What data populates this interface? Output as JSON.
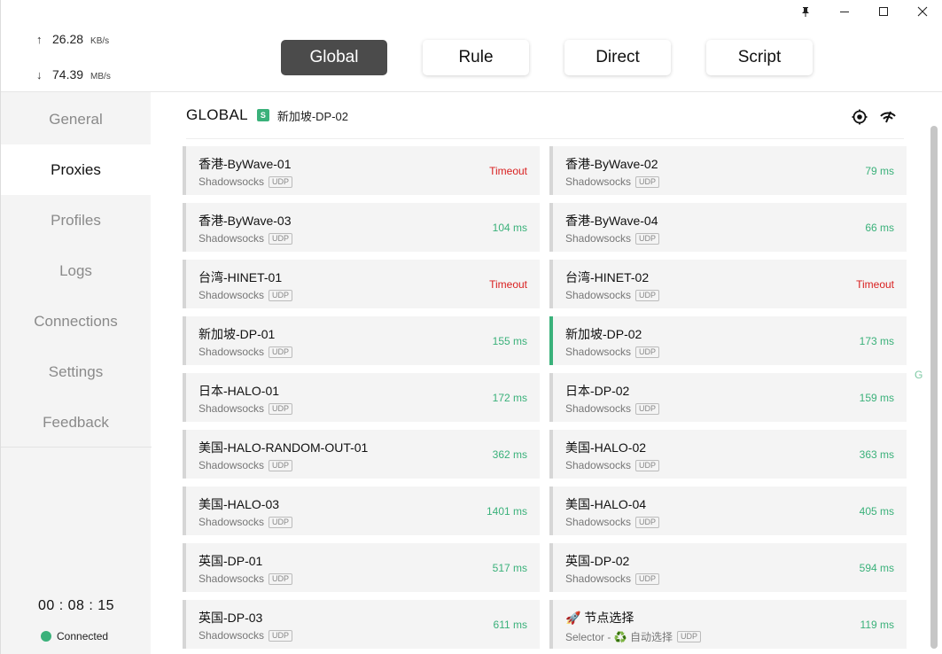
{
  "window": {
    "controls": [
      {
        "icon": "pin-icon"
      },
      {
        "icon": "minimize-icon"
      },
      {
        "icon": "maximize-icon"
      },
      {
        "icon": "close-icon"
      }
    ]
  },
  "traffic": {
    "upload": {
      "arrow": "↑",
      "value": "26.28",
      "unit": "KB/s"
    },
    "download": {
      "arrow": "↓",
      "value": "74.39",
      "unit": "MB/s"
    }
  },
  "nav": {
    "items": [
      "General",
      "Proxies",
      "Profiles",
      "Logs",
      "Connections",
      "Settings",
      "Feedback"
    ],
    "active": "Proxies"
  },
  "footer": {
    "timer": "00 : 08 : 15",
    "status": "Connected"
  },
  "modes": {
    "items": [
      "Global",
      "Rule",
      "Direct",
      "Script"
    ],
    "active": "Global"
  },
  "group": {
    "name": "GLOBAL",
    "badge": "S",
    "selected": "新加坡-DP-02",
    "icons": [
      "locate-icon",
      "speed-test-icon"
    ]
  },
  "proxies": [
    {
      "name": "香港-ByWave-01",
      "type": "Shadowsocks",
      "udp": "UDP",
      "delay": "Timeout",
      "timeout": true
    },
    {
      "name": "香港-ByWave-02",
      "type": "Shadowsocks",
      "udp": "UDP",
      "delay": "79 ms"
    },
    {
      "name": "香港-ByWave-03",
      "type": "Shadowsocks",
      "udp": "UDP",
      "delay": "104 ms"
    },
    {
      "name": "香港-ByWave-04",
      "type": "Shadowsocks",
      "udp": "UDP",
      "delay": "66 ms"
    },
    {
      "name": "台湾-HINET-01",
      "type": "Shadowsocks",
      "udp": "UDP",
      "delay": "Timeout",
      "timeout": true
    },
    {
      "name": "台湾-HINET-02",
      "type": "Shadowsocks",
      "udp": "UDP",
      "delay": "Timeout",
      "timeout": true
    },
    {
      "name": "新加坡-DP-01",
      "type": "Shadowsocks",
      "udp": "UDP",
      "delay": "155 ms"
    },
    {
      "name": "新加坡-DP-02",
      "type": "Shadowsocks",
      "udp": "UDP",
      "delay": "173 ms",
      "selected": true
    },
    {
      "name": "日本-HALO-01",
      "type": "Shadowsocks",
      "udp": "UDP",
      "delay": "172 ms"
    },
    {
      "name": "日本-DP-02",
      "type": "Shadowsocks",
      "udp": "UDP",
      "delay": "159 ms"
    },
    {
      "name": "美国-HALO-RANDOM-OUT-01",
      "type": "Shadowsocks",
      "udp": "UDP",
      "delay": "362 ms"
    },
    {
      "name": "美国-HALO-02",
      "type": "Shadowsocks",
      "udp": "UDP",
      "delay": "363 ms"
    },
    {
      "name": "美国-HALO-03",
      "type": "Shadowsocks",
      "udp": "UDP",
      "delay": "1401 ms"
    },
    {
      "name": "美国-HALO-04",
      "type": "Shadowsocks",
      "udp": "UDP",
      "delay": "405 ms"
    },
    {
      "name": "英国-DP-01",
      "type": "Shadowsocks",
      "udp": "UDP",
      "delay": "517 ms"
    },
    {
      "name": "英国-DP-02",
      "type": "Shadowsocks",
      "udp": "UDP",
      "delay": "594 ms"
    },
    {
      "name": "英国-DP-03",
      "type": "Shadowsocks",
      "udp": "UDP",
      "delay": "611 ms"
    },
    {
      "name": "🚀 节点选择",
      "type": "Selector - ♻️ 自动选择",
      "udp": "UDP",
      "delay": "119 ms"
    }
  ],
  "side_letter": "G",
  "colors": {
    "accent": "#3ab17a",
    "timeout": "#d92020",
    "active_mode": "#4b4b4b"
  }
}
